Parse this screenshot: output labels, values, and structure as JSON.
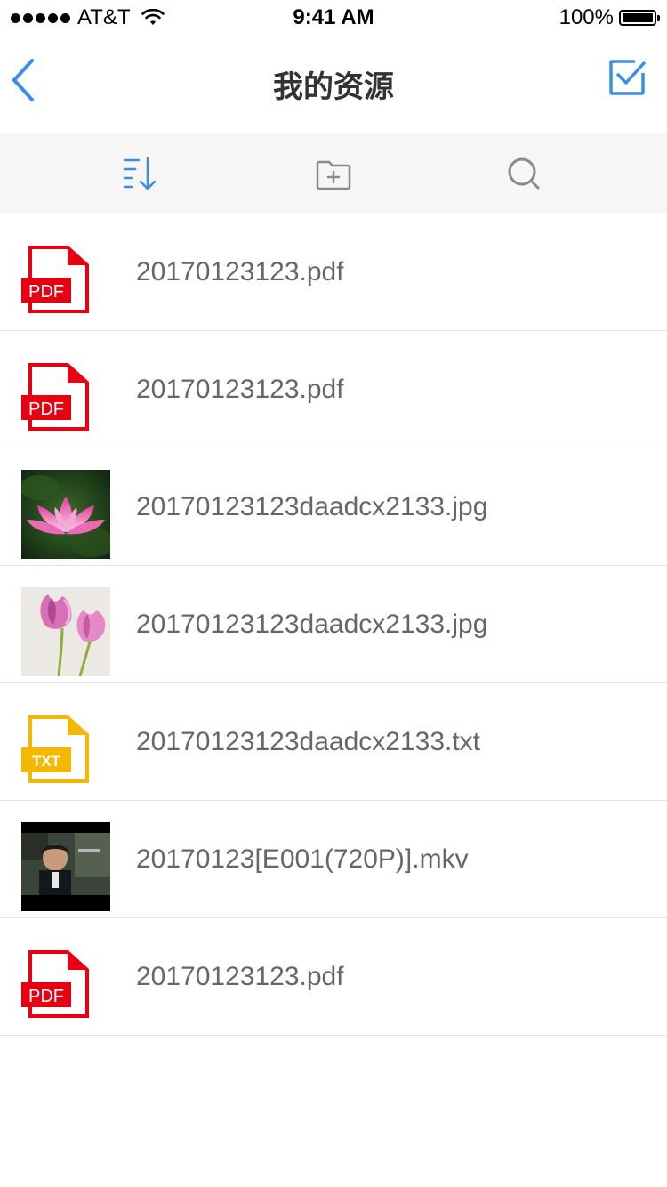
{
  "status": {
    "carrier": "AT&T",
    "time": "9:41 AM",
    "battery": "100%",
    "battery_level": 1.0
  },
  "nav": {
    "title": "我的资源",
    "back_icon": "chevron-left-icon",
    "select_icon": "checkbox-checked-icon"
  },
  "toolbar": {
    "sort_icon": "sort-icon",
    "new_folder_icon": "folder-add-icon",
    "search_icon": "search-icon"
  },
  "files": [
    {
      "name": "20170123123.pdf",
      "type": "pdf",
      "badge": "PDF"
    },
    {
      "name": "20170123123.pdf",
      "type": "pdf",
      "badge": "PDF"
    },
    {
      "name": "20170123123daadcx2133.jpg",
      "type": "image-lotus"
    },
    {
      "name": "20170123123daadcx2133.jpg",
      "type": "image-tulips"
    },
    {
      "name": "20170123123daadcx2133.txt",
      "type": "txt",
      "badge": "TXT"
    },
    {
      "name": "20170123[E001(720P)].mkv",
      "type": "video"
    },
    {
      "name": "20170123123.pdf",
      "type": "pdf",
      "badge": "PDF"
    }
  ],
  "colors": {
    "accent": "#3a8ee6",
    "pdf_red": "#e60012",
    "txt_yellow": "#f5b800",
    "toolbar_bg": "#f6f6f6",
    "text": "#666666"
  }
}
